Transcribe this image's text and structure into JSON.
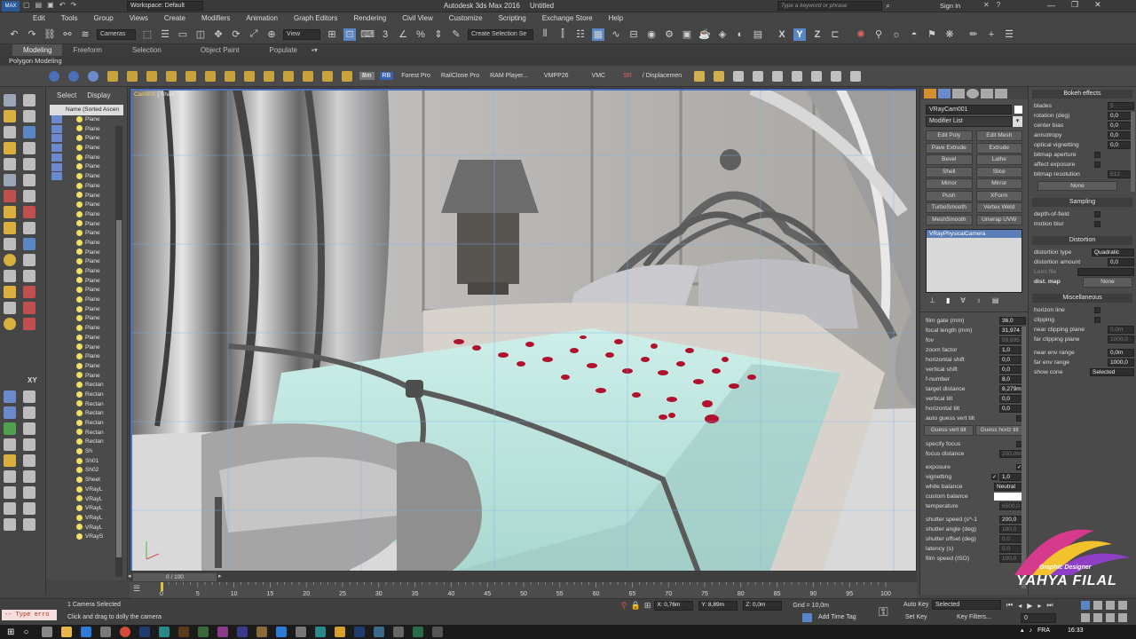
{
  "titlebar": {
    "workspace": "Workspace: Default",
    "app_title": "Autodesk 3ds Max 2016",
    "doc_title": "Untitled",
    "search_placeholder": "Type a keyword or phrase",
    "sign_in": "Sign In"
  },
  "menu": [
    "Edit",
    "Tools",
    "Group",
    "Views",
    "Create",
    "Modifiers",
    "Animation",
    "Graph Editors",
    "Rendering",
    "Civil View",
    "Customize",
    "Scripting",
    "Exchange Store",
    "Help"
  ],
  "toolbar": {
    "filter_dropdown": "Cameras",
    "view_dropdown": "View",
    "selection_set": "Create Selection Se",
    "axis_x": "X",
    "axis_y": "Y",
    "axis_z": "Z",
    "axis_xy": "XY"
  },
  "ribbon": {
    "tabs": [
      "Modeling",
      "Freeform",
      "Selection",
      "Object Paint",
      "Populate"
    ],
    "sub": "Polygon Modeling"
  },
  "plugins": {
    "bm": "Bm",
    "rb": "RB",
    "items": [
      "Forest Pro",
      "RailClone Pro",
      "RAM Player...",
      "VMPP26",
      "VMC",
      "SR",
      "/ Displacemen"
    ]
  },
  "explorer": {
    "tab_select": "Select",
    "tab_display": "Display",
    "col_header": "Name (Sorted Ascen",
    "rows": [
      "Plane",
      "Plane",
      "Plane",
      "Plane",
      "Plane",
      "Plane",
      "Plane",
      "Plane",
      "Plane",
      "Plane",
      "Plane",
      "Plane",
      "Plane",
      "Plane",
      "Plane",
      "Plane",
      "Plane",
      "Plane",
      "Plane",
      "Plane",
      "Plane",
      "Plane",
      "Plane",
      "Plane",
      "Plane",
      "Plane",
      "Plane",
      "Plane",
      "Rectan",
      "Rectan",
      "Rectan",
      "Rectan",
      "Rectan",
      "Rectan",
      "Rectan",
      "Sh",
      "Sh01",
      "Sh02",
      "Sheet",
      "VRayL",
      "VRayL",
      "VRayL",
      "VRayL",
      "VRayL",
      "VRayS"
    ]
  },
  "viewport": {
    "label": "[ + ] [ VRayCam001 ] [ Shade",
    "label_cam": "Cam001",
    "label_shade": "[ Shad"
  },
  "cmd": {
    "object_name": "VRayCam001",
    "modifier_list": "Modifier List",
    "mod_buttons": [
      [
        "Edit Poly",
        "Edit Mesh"
      ],
      [
        "Pave Extrude",
        "Extrude"
      ],
      [
        "Bevel",
        "Lathe"
      ],
      [
        "Shell",
        "Slice"
      ],
      [
        "Mirror",
        "Mirror"
      ],
      [
        "Push",
        "XForm"
      ],
      [
        "TurboSmooth",
        "Vertex Weld"
      ],
      [
        "MeshSmooth",
        "Unwrap UVW"
      ]
    ],
    "stack_item": "VRayPhysicalCamera",
    "params": [
      {
        "label": "film gate (mm)",
        "value": "36,0",
        "dis": false
      },
      {
        "label": "focal length (mm)",
        "value": "31,974",
        "dis": false
      },
      {
        "label": "fov",
        "value": "58,695",
        "dis": true
      },
      {
        "label": "zoom factor",
        "value": "1,0",
        "dis": false
      },
      {
        "label": "horizontal shift",
        "value": "0,0",
        "dis": false
      },
      {
        "label": "vertical shift",
        "value": "0,0",
        "dis": false
      },
      {
        "label": "f-number",
        "value": "8,0",
        "dis": false
      },
      {
        "label": "target distance",
        "value": "8,279m",
        "dis": false
      },
      {
        "label": "vertical tilt",
        "value": "0,0",
        "dis": false
      },
      {
        "label": "horizontal tilt",
        "value": "0,0",
        "dis": false
      }
    ],
    "auto_guess": "auto guess vert tilt",
    "guess_vert": "Guess vert tilt",
    "guess_horiz": "Guess horiz tilt",
    "specify_focus": "specify focus",
    "focus_distance": "focus distance",
    "focus_value": "200,0m",
    "exposure": "exposure",
    "vignetting": "vignetting",
    "vignetting_value": "1,0",
    "white_balance": "white balance",
    "white_balance_value": "Neutral",
    "custom_balance": "custom balance",
    "temperature": "temperature",
    "temperature_value": "6500,0",
    "shutter_speed": "shutter speed (s^-1",
    "shutter_speed_value": "200,0",
    "shutter_angle": "shutter angle (deg)",
    "shutter_angle_value": "180,0",
    "shutter_offset": "shutter offset (deg)",
    "shutter_offset_value": "0,0",
    "latency": "latency (s)",
    "latency_value": "0,0",
    "film_speed": "film speed (ISO)",
    "film_speed_value": "100,0"
  },
  "right": {
    "bokeh_header": "Bokeh effects",
    "bokeh": [
      {
        "label": "blades",
        "value": "5",
        "type": "spin",
        "dis": true
      },
      {
        "label": "rotation (deg)",
        "value": "0,0",
        "type": "spin",
        "dis": false
      },
      {
        "label": "center bias",
        "value": "0,0",
        "type": "spin",
        "dis": false
      },
      {
        "label": "anisotropy",
        "value": "0,0",
        "type": "spin",
        "dis": false
      },
      {
        "label": "optical vignetting",
        "value": "0,0",
        "type": "spin",
        "dis": false
      },
      {
        "label": "bitmap aperture",
        "value": "",
        "type": "chk",
        "dis": false
      },
      {
        "label": "affect exposure",
        "value": "",
        "type": "chk",
        "dis": false
      },
      {
        "label": "bitmap resolution",
        "value": "512",
        "type": "spin",
        "dis": true
      }
    ],
    "none_btn": "None",
    "sampling_header": "Sampling",
    "depth_of_field": "depth-of-field",
    "motion_blur": "motion blur",
    "distortion_header": "Distortion",
    "distortion_type": "distortion type",
    "distortion_type_value": "Quadratic",
    "distortion_amount": "distortion amount",
    "distortion_amount_value": "0,0",
    "lens_file": "Lens file",
    "dist_map": "dist. map",
    "dist_map_none": "None",
    "misc_header": "Miscellaneous",
    "horizon_line": "horizon line",
    "clipping": "clipping",
    "near_clip": "near clipping plane",
    "near_clip_value": "0,0m",
    "far_clip": "far clipping plane",
    "far_clip_value": "1000,0",
    "near_env": "near env range",
    "near_env_value": "0,0m",
    "far_env": "far env range",
    "far_env_value": "1000,0",
    "show_cone": "show cone",
    "show_cone_value": "Selected"
  },
  "timeline": {
    "frame_counter": "0 / 100",
    "ticks": [
      "0",
      "5",
      "10",
      "15",
      "20",
      "25",
      "30",
      "35",
      "40",
      "45",
      "50",
      "55",
      "60",
      "65",
      "70",
      "75",
      "80",
      "85",
      "90",
      "95",
      "100"
    ]
  },
  "status": {
    "maxscript": "-- Type erro",
    "selected": "1 Camera Selected",
    "prompt": "Click and drag to dolly the camera",
    "x_val": "X: 0,76m",
    "y_val": "Y: 8,89m",
    "z_val": "Z: 0,0m",
    "grid": "Grid = 10,0m",
    "add_time_tag": "Add Time Tag",
    "auto_key": "Auto Key",
    "set_key": "Set Key",
    "selected_dd": "Selected",
    "key_filters": "Key Filters...",
    "frame_field": "0"
  },
  "taskbar": {
    "lang": "FRA",
    "time": "16:33"
  },
  "watermark": {
    "line1": "Graphic Designer",
    "line2": "YAHYA FILAL"
  },
  "colors": {
    "accent": "#4a6fbf",
    "bedsheet": "#bfe7e1",
    "petal": "#b0122e",
    "bulb": "#f2e063"
  }
}
